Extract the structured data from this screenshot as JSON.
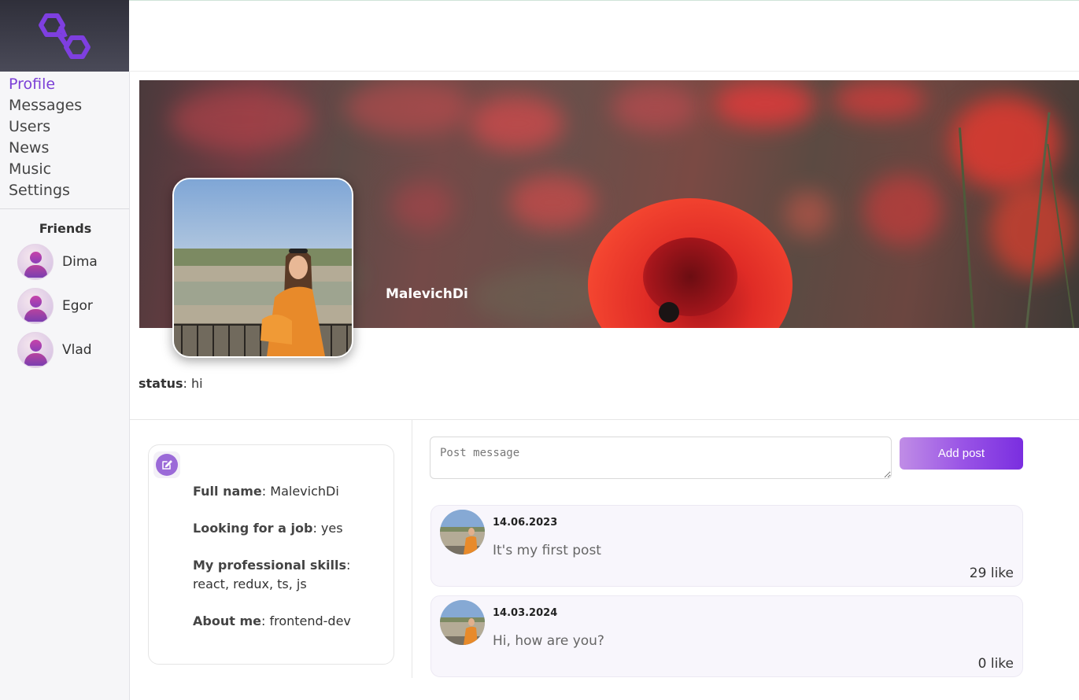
{
  "sidebar": {
    "logo": "polygon-logo",
    "nav": [
      {
        "label": "Profile",
        "active": true
      },
      {
        "label": "Messages",
        "active": false
      },
      {
        "label": "Users",
        "active": false
      },
      {
        "label": "News",
        "active": false
      },
      {
        "label": "Music",
        "active": false
      },
      {
        "label": "Settings",
        "active": false
      }
    ],
    "friends_title": "Friends",
    "friends": [
      {
        "name": "Dima"
      },
      {
        "name": "Egor"
      },
      {
        "name": "Vlad"
      }
    ]
  },
  "profile": {
    "name": "MalevichDi",
    "status_label": "status",
    "status_value": "hi"
  },
  "info": {
    "full_name_label": "Full name",
    "full_name_value": "MalevichDi",
    "job_label": "Looking for a job",
    "job_value": "yes",
    "skills_label": "My professional skills",
    "skills_value": "react, redux, ts, js",
    "about_label": "About me",
    "about_value": "frontend-dev"
  },
  "composer": {
    "placeholder": "Post message",
    "button_label": "Add post"
  },
  "posts": [
    {
      "date": "14.06.2023",
      "text": "It's my first post",
      "likes": "29",
      "likes_word": "like"
    },
    {
      "date": "14.03.2024",
      "text": "Hi, how are you?",
      "likes": "0",
      "likes_word": "like"
    }
  ],
  "colors": {
    "accent": "#7b3fd6",
    "button_start": "#c08de6",
    "button_end": "#7a2ee0",
    "post_bg": "#f8f6fc"
  }
}
